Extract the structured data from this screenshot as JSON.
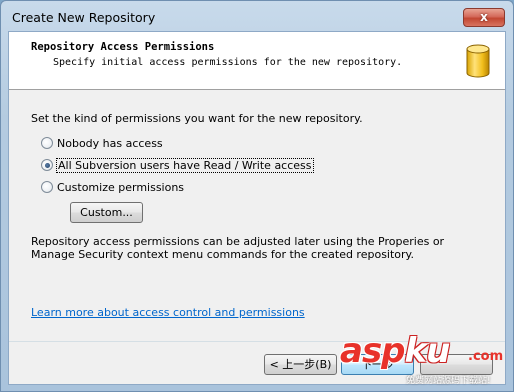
{
  "window": {
    "title": "Create New Repository",
    "close_glyph": "x"
  },
  "header": {
    "title": "Repository Access Permissions",
    "subtitle": "Specify initial access permissions for the new repository.",
    "icon": "database-icon"
  },
  "intro": "Set the kind of permissions you want for the new repository.",
  "options": [
    {
      "label": "Nobody has access",
      "checked": false
    },
    {
      "label": "All Subversion users have Read / Write access",
      "checked": true
    },
    {
      "label": "Customize permissions",
      "checked": false
    }
  ],
  "custom_button": "Custom...",
  "note": "Repository access permissions can be adjusted later using the Properies or Manage Security context menu commands for the created repository.",
  "link": "Learn more about access control and permissions",
  "footer": {
    "back_label": "< 上一步(B)",
    "next_label": "下一步"
  },
  "watermark": {
    "asp": "asp",
    "ku": "ku",
    "com": ".com",
    "sub": "免费网站源码下载站!"
  },
  "colors": {
    "link": "#0066cc",
    "close_button": "#c24732",
    "watermark": "#e8322a"
  }
}
